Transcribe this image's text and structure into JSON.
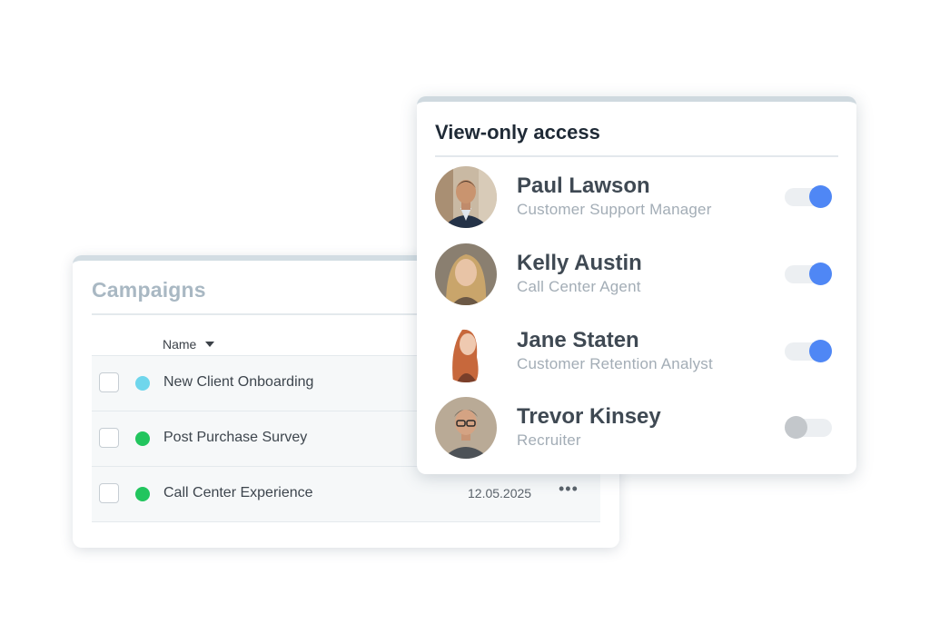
{
  "campaigns": {
    "title": "Campaigns",
    "column_name": "Name",
    "rows": [
      {
        "name": "New Client Onboarding",
        "status_color": "#6fd6ec",
        "date": "",
        "more": ""
      },
      {
        "name": "Post Purchase Survey",
        "status_color": "#22c55e",
        "date": "",
        "more": ""
      },
      {
        "name": "Call Center Experience",
        "status_color": "#22c55e",
        "date": "12.05.2025",
        "more": "•••"
      }
    ]
  },
  "access": {
    "title": "View-only access",
    "people": [
      {
        "name": "Paul Lawson",
        "role": "Customer Support Manager",
        "enabled": true
      },
      {
        "name": "Kelly Austin",
        "role": "Call Center Agent",
        "enabled": true
      },
      {
        "name": "Jane Staten",
        "role": "Customer Retention Analyst",
        "enabled": true
      },
      {
        "name": "Trevor Kinsey",
        "role": "Recruiter",
        "enabled": false
      }
    ]
  },
  "colors": {
    "toggle_on": "#4f87f5",
    "toggle_off": "#c3c7cb"
  }
}
